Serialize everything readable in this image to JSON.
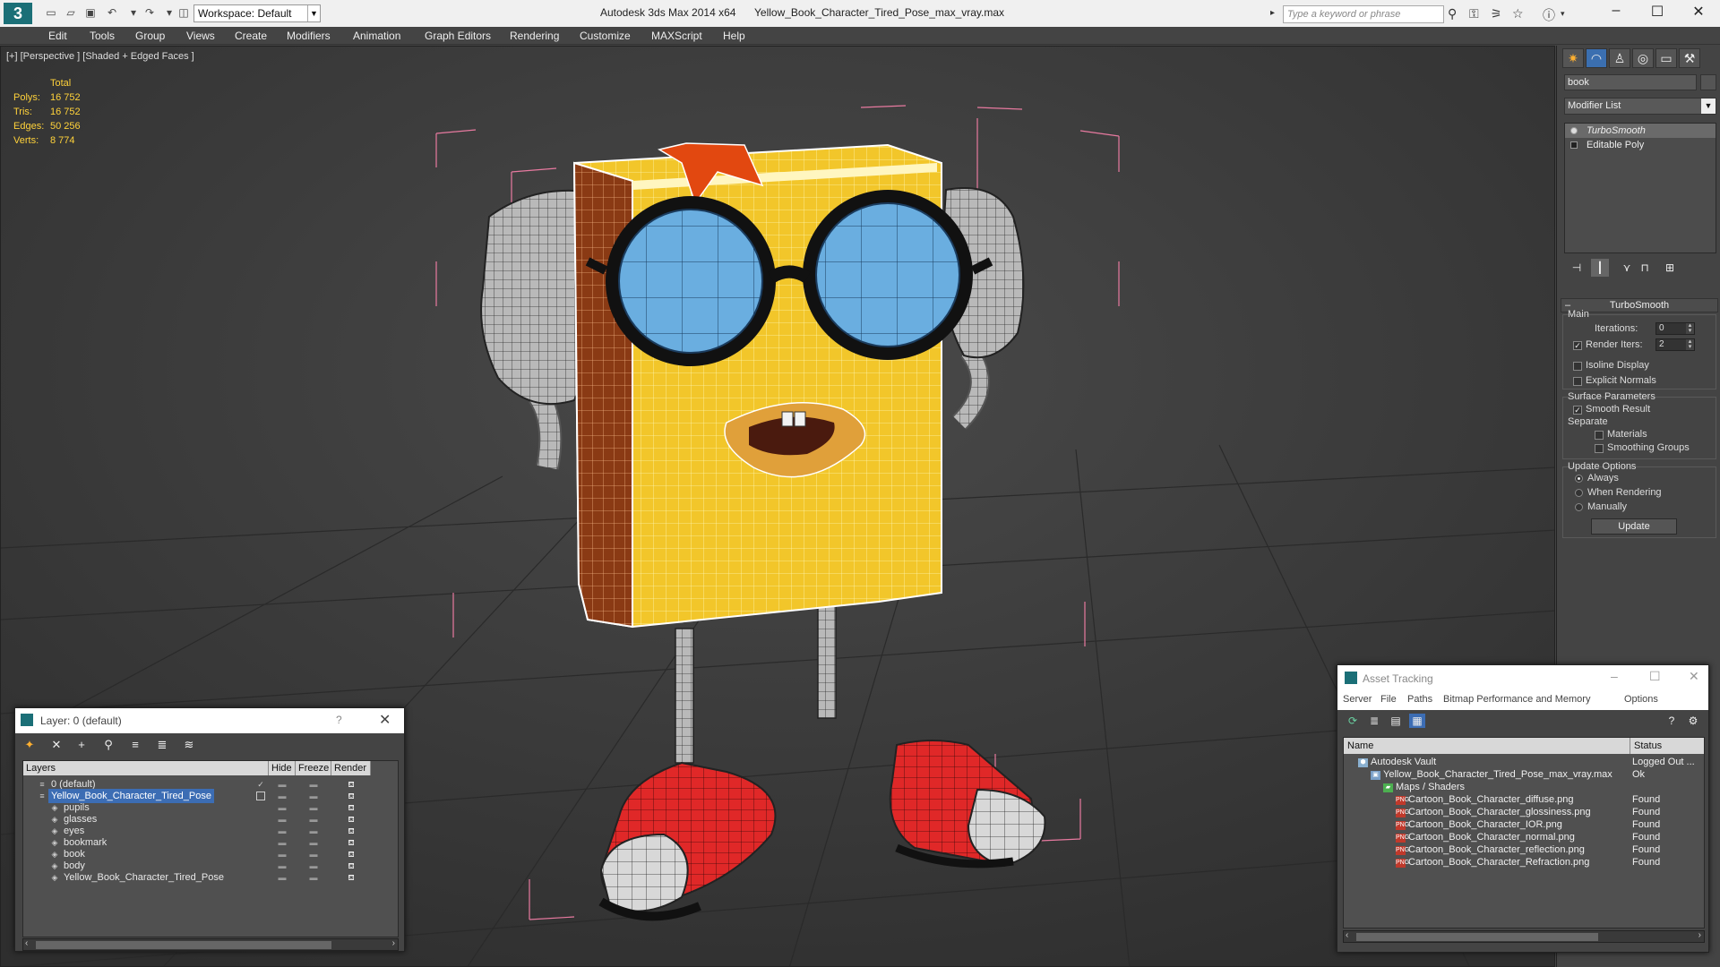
{
  "titlebar": {
    "app_title": "Autodesk 3ds Max 2014 x64",
    "file_name": "Yellow_Book_Character_Tired_Pose_max_vray.max",
    "workspace": "Workspace: Default",
    "search_placeholder": "Type a keyword or phrase",
    "logo": "3"
  },
  "menu": [
    "Edit",
    "Tools",
    "Group",
    "Views",
    "Create",
    "Modifiers",
    "Animation",
    "Graph Editors",
    "Rendering",
    "Customize",
    "MAXScript",
    "Help"
  ],
  "viewport": {
    "label": "[+] [Perspective ] [Shaded + Edged Faces ]",
    "stats": {
      "header": "Total",
      "rows": [
        {
          "k": "Polys:",
          "v": "16 752"
        },
        {
          "k": "Tris:",
          "v": "16 752"
        },
        {
          "k": "Edges:",
          "v": "50 256"
        },
        {
          "k": "Verts:",
          "v": "8 774"
        }
      ]
    }
  },
  "command_panel": {
    "object_name": "book",
    "modifier_list": "Modifier List",
    "stack": [
      {
        "label": "TurboSmooth",
        "selected": true
      },
      {
        "label": "Editable Poly",
        "selected": false
      }
    ],
    "rollout_title": "TurboSmooth",
    "main_label": "Main",
    "iterations_label": "Iterations:",
    "iterations_value": "0",
    "render_iters_label": "Render Iters:",
    "render_iters_value": "2",
    "isoline_label": "Isoline Display",
    "explicit_normals_label": "Explicit Normals",
    "surface_params_label": "Surface Parameters",
    "smooth_result_label": "Smooth Result",
    "separate_label": "Separate",
    "materials_label": "Materials",
    "smoothing_groups_label": "Smoothing Groups",
    "update_options_label": "Update Options",
    "always_label": "Always",
    "when_rendering_label": "When Rendering",
    "manually_label": "Manually",
    "update_button": "Update"
  },
  "layer_window": {
    "title": "Layer: 0 (default)",
    "help": "?",
    "columns": [
      "Layers",
      "Hide",
      "Freeze",
      "Render"
    ],
    "rows": [
      {
        "name": "0 (default)",
        "indent": 0,
        "selected": false
      },
      {
        "name": "Yellow_Book_Character_Tired_Pose",
        "indent": 0,
        "selected": true
      },
      {
        "name": "pupils",
        "indent": 1,
        "selected": false
      },
      {
        "name": "glasses",
        "indent": 1,
        "selected": false
      },
      {
        "name": "eyes",
        "indent": 1,
        "selected": false
      },
      {
        "name": "bookmark",
        "indent": 1,
        "selected": false
      },
      {
        "name": "book",
        "indent": 1,
        "selected": false
      },
      {
        "name": "body",
        "indent": 1,
        "selected": false
      },
      {
        "name": "Yellow_Book_Character_Tired_Pose",
        "indent": 1,
        "selected": false
      }
    ]
  },
  "asset_window": {
    "title": "Asset Tracking",
    "menu": [
      "Server",
      "File",
      "Paths",
      "Bitmap Performance and Memory",
      "Options"
    ],
    "columns": [
      "Name",
      "Status"
    ],
    "rows": [
      {
        "name": "Autodesk Vault",
        "status": "Logged Out ...",
        "indent": 0,
        "icon": "vault"
      },
      {
        "name": "Yellow_Book_Character_Tired_Pose_max_vray.max",
        "status": "Ok",
        "indent": 1,
        "icon": "max"
      },
      {
        "name": "Maps / Shaders",
        "status": "",
        "indent": 2,
        "icon": "folder"
      },
      {
        "name": "Cartoon_Book_Character_diffuse.png",
        "status": "Found",
        "indent": 3,
        "icon": "png"
      },
      {
        "name": "Cartoon_Book_Character_glossiness.png",
        "status": "Found",
        "indent": 3,
        "icon": "png"
      },
      {
        "name": "Cartoon_Book_Character_IOR.png",
        "status": "Found",
        "indent": 3,
        "icon": "png"
      },
      {
        "name": "Cartoon_Book_Character_normal.png",
        "status": "Found",
        "indent": 3,
        "icon": "png"
      },
      {
        "name": "Cartoon_Book_Character_reflection.png",
        "status": "Found",
        "indent": 3,
        "icon": "png"
      },
      {
        "name": "Cartoon_Book_Character_Refraction.png",
        "status": "Found",
        "indent": 3,
        "icon": "png"
      }
    ]
  },
  "colors": {
    "stats_text": "#ffd23a",
    "selection": "#3c6db4",
    "book_yellow": "#f2c62a",
    "spine_brown": "#8a3a14",
    "lens_blue": "#6aaee0",
    "shoe_red": "#e02828",
    "bbox_pink": "#e87aa0"
  }
}
